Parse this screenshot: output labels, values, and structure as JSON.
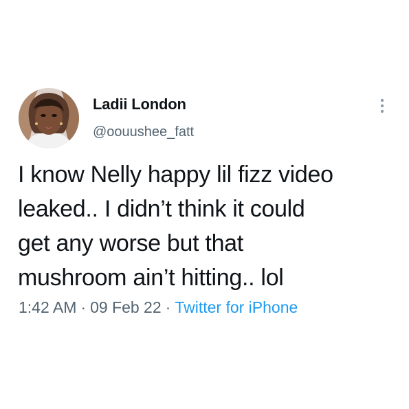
{
  "tweet": {
    "author": {
      "display_name": "Ladii London",
      "handle": "@oouushee_fatt",
      "avatar_icon": "profile-photo"
    },
    "menu_icon": "more-vertical-icon",
    "text_lines": [
      "I know Nelly happy lil fizz video",
      "leaked.. I didn’t think it could",
      "get any worse but that",
      "mushroom ain’t hitting.. lol"
    ],
    "meta": {
      "time": "1:42 AM",
      "separator": "·",
      "date": "09 Feb 22",
      "source": "Twitter for iPhone"
    },
    "colors": {
      "text": "#0f1419",
      "secondary": "#536471",
      "link": "#1d9bf0"
    }
  }
}
